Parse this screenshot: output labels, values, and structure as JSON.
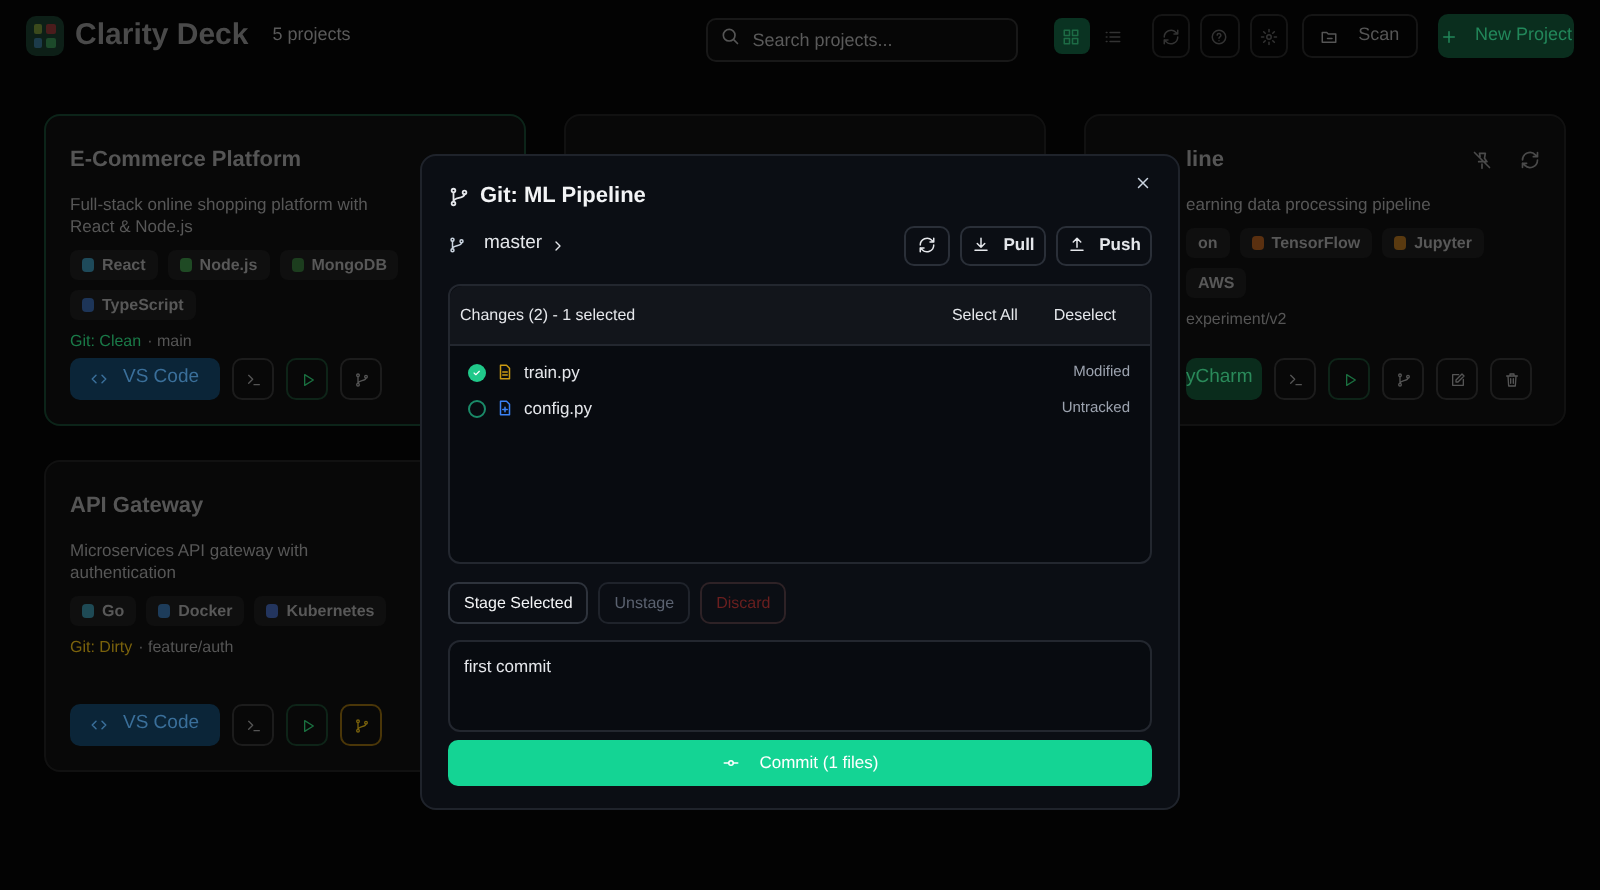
{
  "header": {
    "title": "Clarity Deck",
    "count": "5 projects",
    "search": {
      "placeholder": "Search projects..."
    },
    "view_toggle": [
      {
        "kind": "grid",
        "selected": true
      },
      {
        "kind": "list",
        "selected": false
      }
    ],
    "scan_button": "Scan",
    "new_project_button": "New Project"
  },
  "projects": [
    {
      "title": "E-Commerce Platform",
      "description": "Full-stack online shopping platform with React & Node.js",
      "tags": [
        {
          "label": "React",
          "color": "#1e4a5a"
        },
        {
          "label": "Node.js",
          "color": "#1f4a24"
        },
        {
          "label": "MongoDB",
          "color": "#1c3d1e"
        },
        {
          "label": "TypeScript",
          "color": "#1d3558"
        }
      ],
      "git": {
        "kind": "clean",
        "label": "Git: Clean"
      },
      "branch": "· main",
      "ide": {
        "kind": "vscode",
        "label": "VS Code"
      },
      "actions": [
        {
          "kind": "terminal"
        },
        {
          "kind": "play"
        },
        {
          "kind": "git"
        }
      ]
    },
    {
      "title": "line",
      "description": "earning data processing pipeline",
      "tags": [
        {
          "label": "on"
        },
        {
          "label": "TensorFlow",
          "color": "#5a3010"
        },
        {
          "label": "Jupyter",
          "color": "#5a3a10"
        },
        {
          "label": "AWS"
        }
      ],
      "branch": "experiment/v2",
      "ide": {
        "kind": "pycharm",
        "label": "yCharm"
      },
      "actions": [
        {
          "kind": "terminal"
        },
        {
          "kind": "play"
        },
        {
          "kind": "git"
        },
        {
          "kind": "edit"
        },
        {
          "kind": "trash"
        }
      ],
      "header_icons": [
        {
          "kind": "pin-off"
        },
        {
          "kind": "refresh"
        }
      ]
    },
    {
      "title": "API Gateway",
      "description": "Microservices API gateway with authentication",
      "tags": [
        {
          "label": "Go",
          "color": "#1e4a55"
        },
        {
          "label": "Docker",
          "color": "#1d3c5a"
        },
        {
          "label": "Kubernetes",
          "color": "#23355e"
        }
      ],
      "git": {
        "kind": "dirty",
        "label": "Git: Dirty"
      },
      "branch": "· feature/auth",
      "ide": {
        "kind": "vscode",
        "label": "VS Code"
      },
      "actions": [
        {
          "kind": "terminal"
        },
        {
          "kind": "play"
        },
        {
          "kind": "git"
        }
      ]
    }
  ],
  "git_dialog": {
    "title": "Git: ML Pipeline",
    "branch": "master",
    "pull_button": "Pull",
    "push_button": "Push",
    "changes": {
      "heading": "Changes (2) - 1 selected",
      "select_all": "Select All",
      "deselect": "Deselect",
      "files": [
        {
          "name": "train.py",
          "status": "Modified",
          "kind": "modified",
          "checked": true
        },
        {
          "name": "config.py",
          "status": "Untracked",
          "kind": "untracked",
          "checked": false
        }
      ]
    },
    "actions": [
      {
        "label": "Stage Selected",
        "kind": "normal",
        "disabled": false
      },
      {
        "label": "Unstage",
        "kind": "normal",
        "disabled": true
      },
      {
        "label": "Discard",
        "kind": "danger",
        "disabled": true
      }
    ],
    "message": {
      "value": "first commit"
    },
    "commit_button": "Commit (1 files)"
  }
}
